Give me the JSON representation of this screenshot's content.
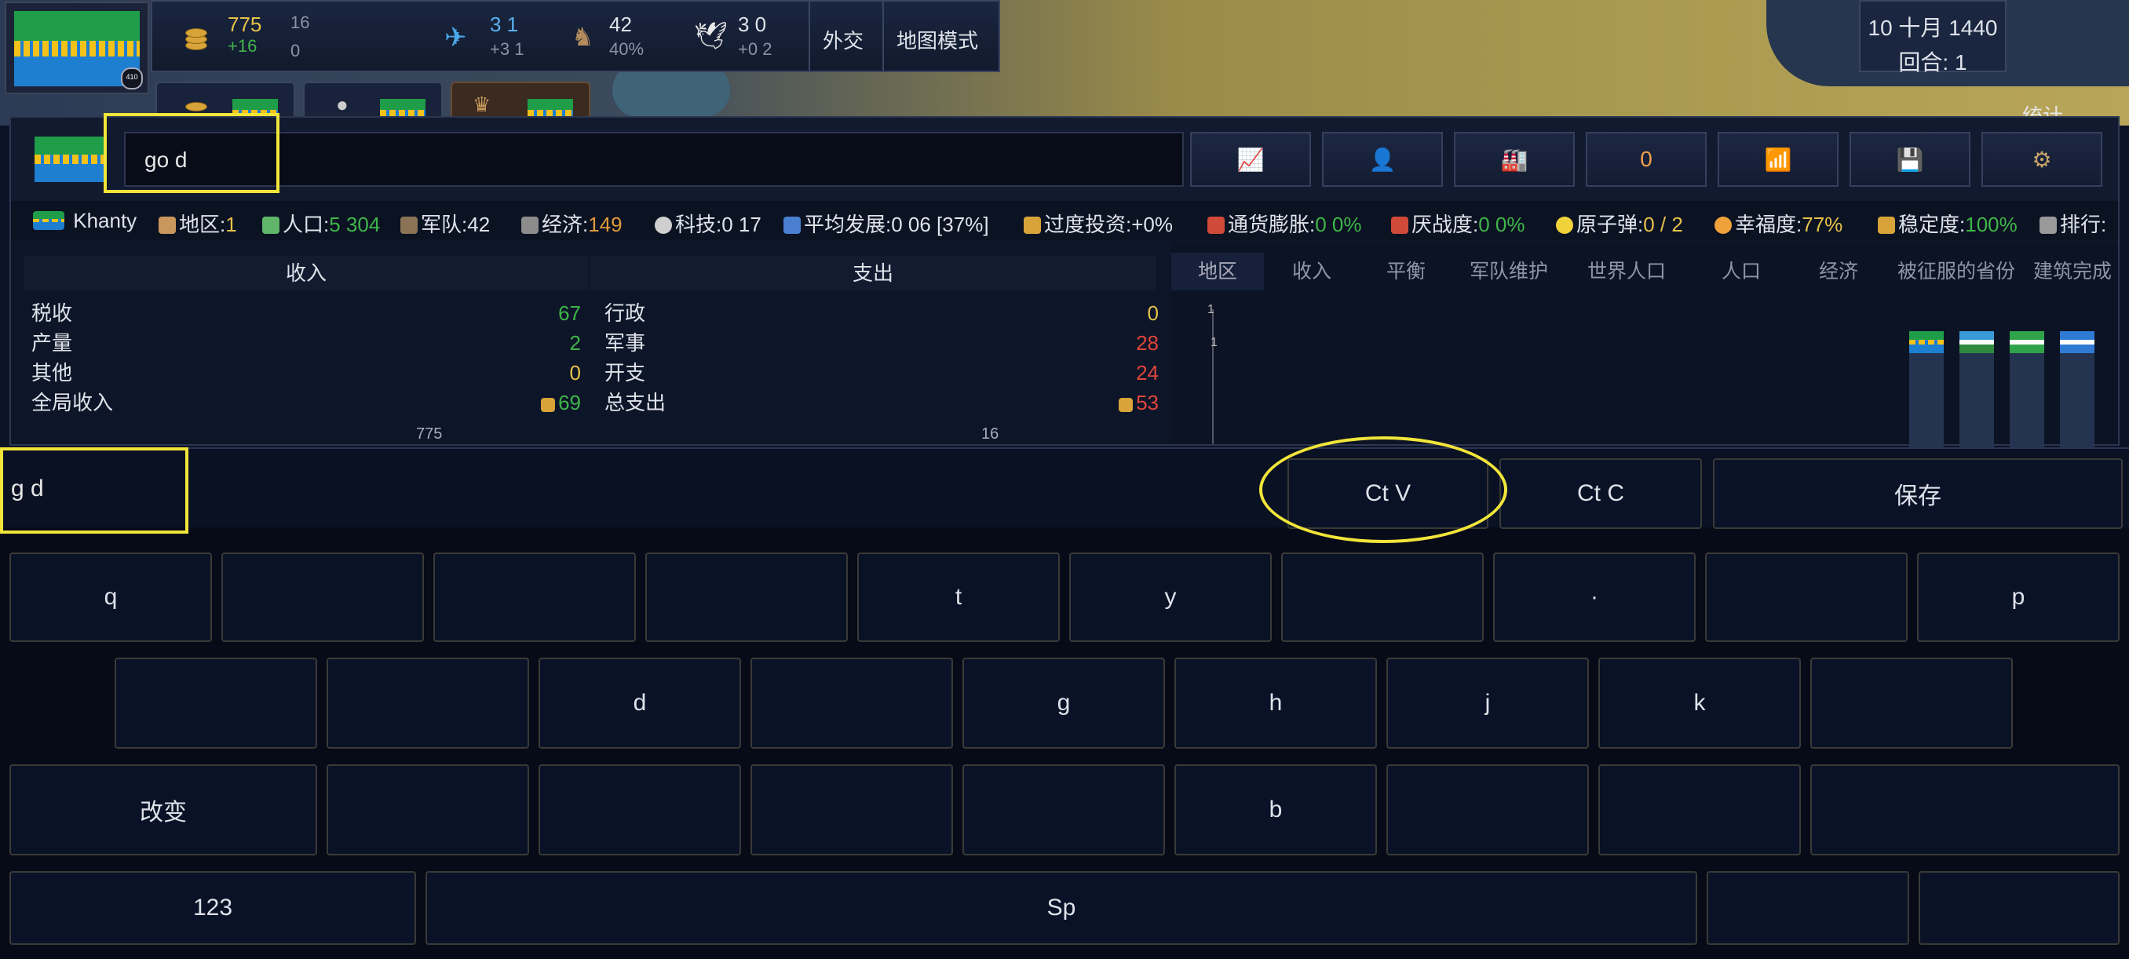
{
  "top": {
    "gold": "775",
    "gold_delta": "+16",
    "gold_small_a": "16",
    "gold_small_b": "0",
    "diplo": "3 1",
    "diplo_delta": "+3 1",
    "army": "42",
    "army_pct": "40%",
    "peace": "3 0",
    "peace_delta": "+0 2",
    "foreign": "外交",
    "map_mode": "地图模式",
    "date": "10 十月 1440",
    "turn": "回合: 1",
    "level": "410",
    "stats_label": "统计"
  },
  "panel": {
    "search_value": "go d",
    "toolbar_counter": "0"
  },
  "stats": {
    "country": "Khanty",
    "region_label": "地区:",
    "region": "1",
    "pop_label": "人口:",
    "pop": "5 304",
    "army_label": "军队:",
    "army": "42",
    "econ_label": "经济:",
    "econ": "149",
    "tech_label": "科技:",
    "tech": "0 17",
    "dev_label": "平均发展:",
    "dev": "0 06 [37%]",
    "invest_label": "过度投资:",
    "invest": "+0%",
    "infl_label": "通货膨胀:",
    "infl": "0 0%",
    "war_label": "厌战度:",
    "war": "0 0%",
    "nuke_label": "原子弹:",
    "nuke": "0 / 2",
    "happy_label": "幸福度:",
    "happy": "77%",
    "stab_label": "稳定度:",
    "stab": "100%",
    "rank_label": "排行:"
  },
  "ledger": {
    "income_title": "收入",
    "expense_title": "支出",
    "income": [
      {
        "label": "税收",
        "value": "67"
      },
      {
        "label": "产量",
        "value": "2"
      },
      {
        "label": "其他",
        "value": "0"
      },
      {
        "label": "全局收入",
        "value": "69"
      }
    ],
    "expense": [
      {
        "label": "行政",
        "value": "0"
      },
      {
        "label": "军事",
        "value": "28"
      },
      {
        "label": "开支",
        "value": "24"
      },
      {
        "label": "总支出",
        "value": "53"
      }
    ],
    "treasury": "775",
    "balance": "16"
  },
  "right_tabs": [
    "地区",
    "收入",
    "平衡",
    "军队维护",
    "世界人口",
    "人口",
    "经济",
    "被征服的省份",
    "建筑完成"
  ],
  "chart_axis": [
    "1",
    "1"
  ],
  "keyboard": {
    "input_value": "g  d",
    "paste": "Ct    V",
    "copy": "Ct    C",
    "save": "保存",
    "row1": [
      "q",
      "",
      "",
      "",
      "t",
      "y",
      "",
      "·",
      "",
      "p"
    ],
    "row2": [
      "",
      "",
      "d",
      "",
      "g",
      "h",
      "j",
      "k",
      ""
    ],
    "row3": [
      "改变",
      "",
      "",
      "",
      "",
      "b",
      "",
      "",
      ""
    ],
    "num": "123",
    "space": "Sp"
  },
  "colors": {
    "highlight": "#f1e53a",
    "positive": "#3fb64a",
    "negative": "#e0463c",
    "gold": "#e6c24a"
  }
}
